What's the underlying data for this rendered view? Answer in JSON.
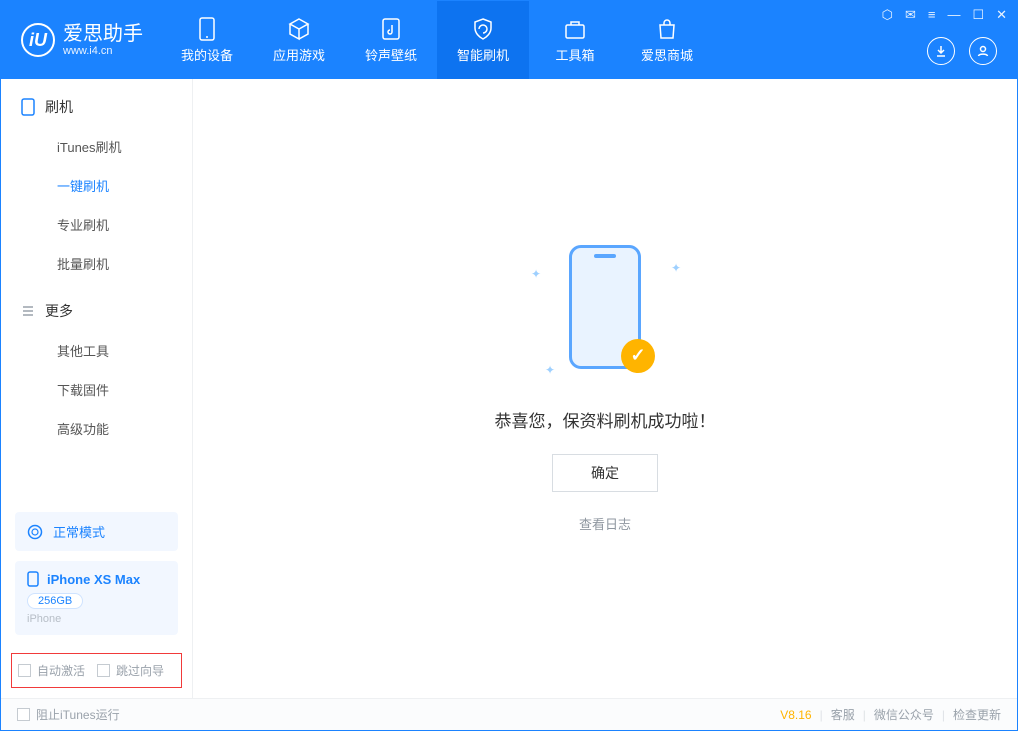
{
  "app": {
    "title": "爱思助手",
    "subtitle": "www.i4.cn"
  },
  "nav": {
    "items": [
      {
        "label": "我的设备"
      },
      {
        "label": "应用游戏"
      },
      {
        "label": "铃声壁纸"
      },
      {
        "label": "智能刷机"
      },
      {
        "label": "工具箱"
      },
      {
        "label": "爱思商城"
      }
    ]
  },
  "sidebar": {
    "section1": {
      "title": "刷机",
      "items": [
        "iTunes刷机",
        "一键刷机",
        "专业刷机",
        "批量刷机"
      ]
    },
    "section2": {
      "title": "更多",
      "items": [
        "其他工具",
        "下载固件",
        "高级功能"
      ]
    },
    "mode": "正常模式",
    "device": {
      "name": "iPhone XS Max",
      "storage": "256GB",
      "type": "iPhone"
    },
    "bottom_checks": {
      "auto_activate": "自动激活",
      "skip_guide": "跳过向导"
    }
  },
  "main": {
    "success_text": "恭喜您，保资料刷机成功啦！",
    "ok_button": "确定",
    "view_log": "查看日志"
  },
  "footer": {
    "block_itunes": "阻止iTunes运行",
    "version": "V8.16",
    "links": [
      "客服",
      "微信公众号",
      "检查更新"
    ]
  }
}
